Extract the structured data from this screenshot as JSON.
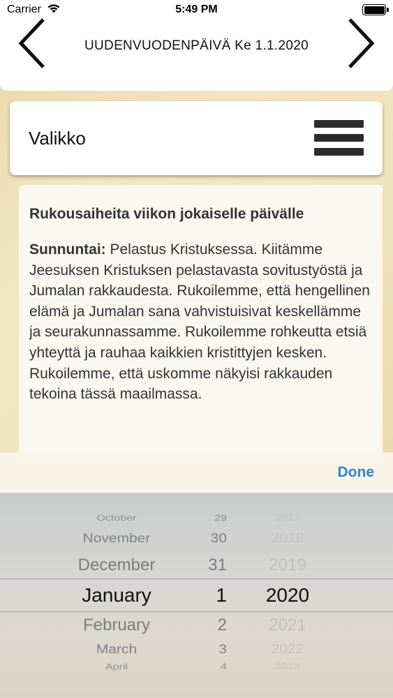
{
  "status_bar": {
    "carrier": "Carrier",
    "time": "5:49 PM"
  },
  "header": {
    "date_title": "UUDENVUODENPÄIVÄ Ke 1.1.2020",
    "prev_icon": "chevron-left-icon",
    "next_icon": "chevron-right-icon"
  },
  "menu": {
    "label": "Valikko",
    "icon": "hamburger-menu-icon"
  },
  "content": {
    "heading": "Rukousaiheita viikon jokaiselle päivälle",
    "day_label": "Sunnuntai:",
    "day_text": " Pelastus Kristuksessa. Kiitämme Jeesuksen Kristuksen pelastavasta sovitustyöstä ja Jumalan rakkaudesta. Rukoilemme, että hengellinen elämä ja Jumalan sana vahvistuisivat keskellämme ja seurakunnassamme. Rukoilemme rohkeutta etsiä yhteyttä ja rauhaa kaikkien kristittyjen kesken. Rukoilemme, että uskomme näkyisi rakkauden tekoina tässä maailmassa."
  },
  "toolbar": {
    "done_label": "Done",
    "accent_color": "#2f86d6"
  },
  "picker": {
    "rows": [
      {
        "month": "October",
        "day": "29",
        "year": "2017"
      },
      {
        "month": "November",
        "day": "30",
        "year": "2018"
      },
      {
        "month": "December",
        "day": "31",
        "year": "2019"
      },
      {
        "month": "January",
        "day": "1",
        "year": "2020"
      },
      {
        "month": "February",
        "day": "2",
        "year": "2021"
      },
      {
        "month": "March",
        "day": "3",
        "year": "2022"
      },
      {
        "month": "April",
        "day": "4",
        "year": "2023"
      }
    ],
    "selected": {
      "month": "January",
      "day": "1",
      "year": "2020"
    }
  }
}
